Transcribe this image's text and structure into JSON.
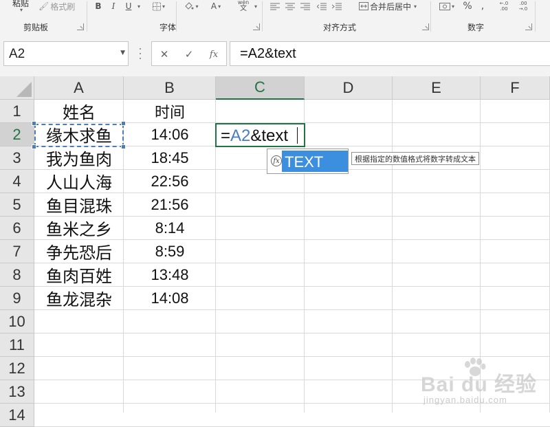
{
  "ribbon": {
    "paste_label": "粘贴",
    "format_painter_label": "格式刷",
    "bold": "B",
    "italic": "I",
    "underline": "U",
    "font_color_letter": "A",
    "wen_label": "wén",
    "wen_char": "文",
    "merge_center_label": "合并后居中",
    "percent": "%",
    "comma": ",",
    "inc_decimal": "←.0 .00",
    "dec_decimal": ".00 →.0",
    "groups": {
      "clipboard": "剪贴板",
      "font": "字体",
      "alignment": "对齐方式",
      "number": "数字"
    }
  },
  "formula_bar": {
    "name_box": "A2",
    "cancel_glyph": "✕",
    "enter_glyph": "✓",
    "fx_glyph": "fx",
    "formula": "=A2&text"
  },
  "columns": [
    "A",
    "B",
    "C",
    "D",
    "E",
    "F"
  ],
  "rows": [
    "1",
    "2",
    "3",
    "4",
    "5",
    "6",
    "7",
    "8",
    "9",
    "10",
    "11",
    "12",
    "13",
    "14"
  ],
  "active_cell": {
    "column": "C",
    "row": "2"
  },
  "cells": {
    "header_name": "姓名",
    "header_time": "时间",
    "data": [
      {
        "name": "缘木求鱼",
        "time": "14:06"
      },
      {
        "name": "我为鱼肉",
        "time": "18:45"
      },
      {
        "name": "人山人海",
        "time": "22:56"
      },
      {
        "name": "鱼目混珠",
        "time": "21:56"
      },
      {
        "name": "鱼米之乡",
        "time": "8:14"
      },
      {
        "name": "争先恐后",
        "time": "8:59"
      },
      {
        "name": "鱼肉百姓",
        "time": "13:48"
      },
      {
        "name": "鱼龙混杂",
        "time": "14:08"
      }
    ]
  },
  "edit_cell": {
    "prefix": "=",
    "ref": "A2",
    "rest": "&text"
  },
  "autocomplete": {
    "icon": "fx",
    "item": "TEXT",
    "tooltip": "根据指定的数值格式将数字转成文本"
  },
  "watermark": {
    "brand": "Bai du 经验",
    "url": "jingyan.baidu.com"
  },
  "colors": {
    "excel_green": "#217346",
    "selection_blue": "#4a7ebb",
    "autocomplete_blue": "#3b8fde"
  }
}
